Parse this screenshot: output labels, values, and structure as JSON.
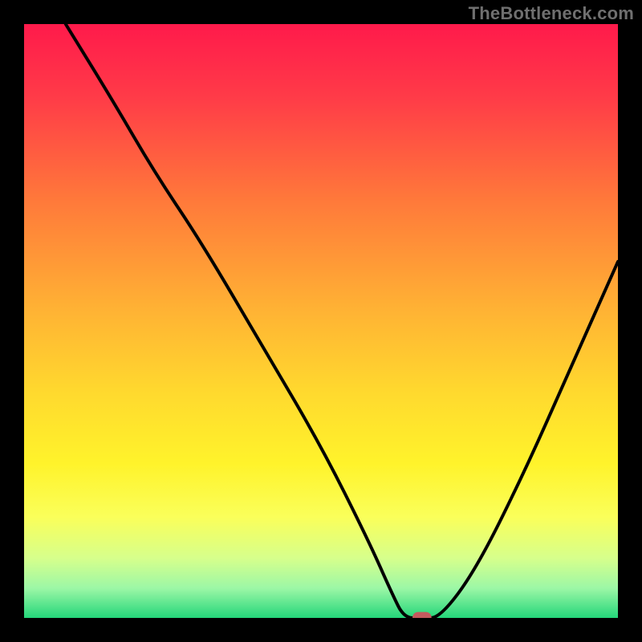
{
  "watermark": "TheBottleneck.com",
  "colors": {
    "page_bg": "#000000",
    "gradient_top": "#ff1a4b",
    "gradient_bottom": "#24d67a",
    "curve": "#000000",
    "marker": "#c45a5e",
    "watermark": "#6f6f6f"
  },
  "chart_data": {
    "type": "line",
    "title": "",
    "xlabel": "",
    "ylabel": "",
    "xlim": [
      0,
      100
    ],
    "ylim": [
      0,
      100
    ],
    "x": [
      7,
      15,
      22,
      30,
      40,
      50,
      58,
      62,
      64,
      67,
      70,
      76,
      84,
      92,
      100
    ],
    "y": [
      100,
      87,
      75,
      63,
      46,
      29,
      13,
      4,
      0,
      0,
      0,
      8,
      24,
      42,
      60
    ],
    "marker": {
      "x": 67,
      "y": 0,
      "w": 3.2,
      "h": 2.0
    },
    "annotations": [],
    "legend": []
  }
}
